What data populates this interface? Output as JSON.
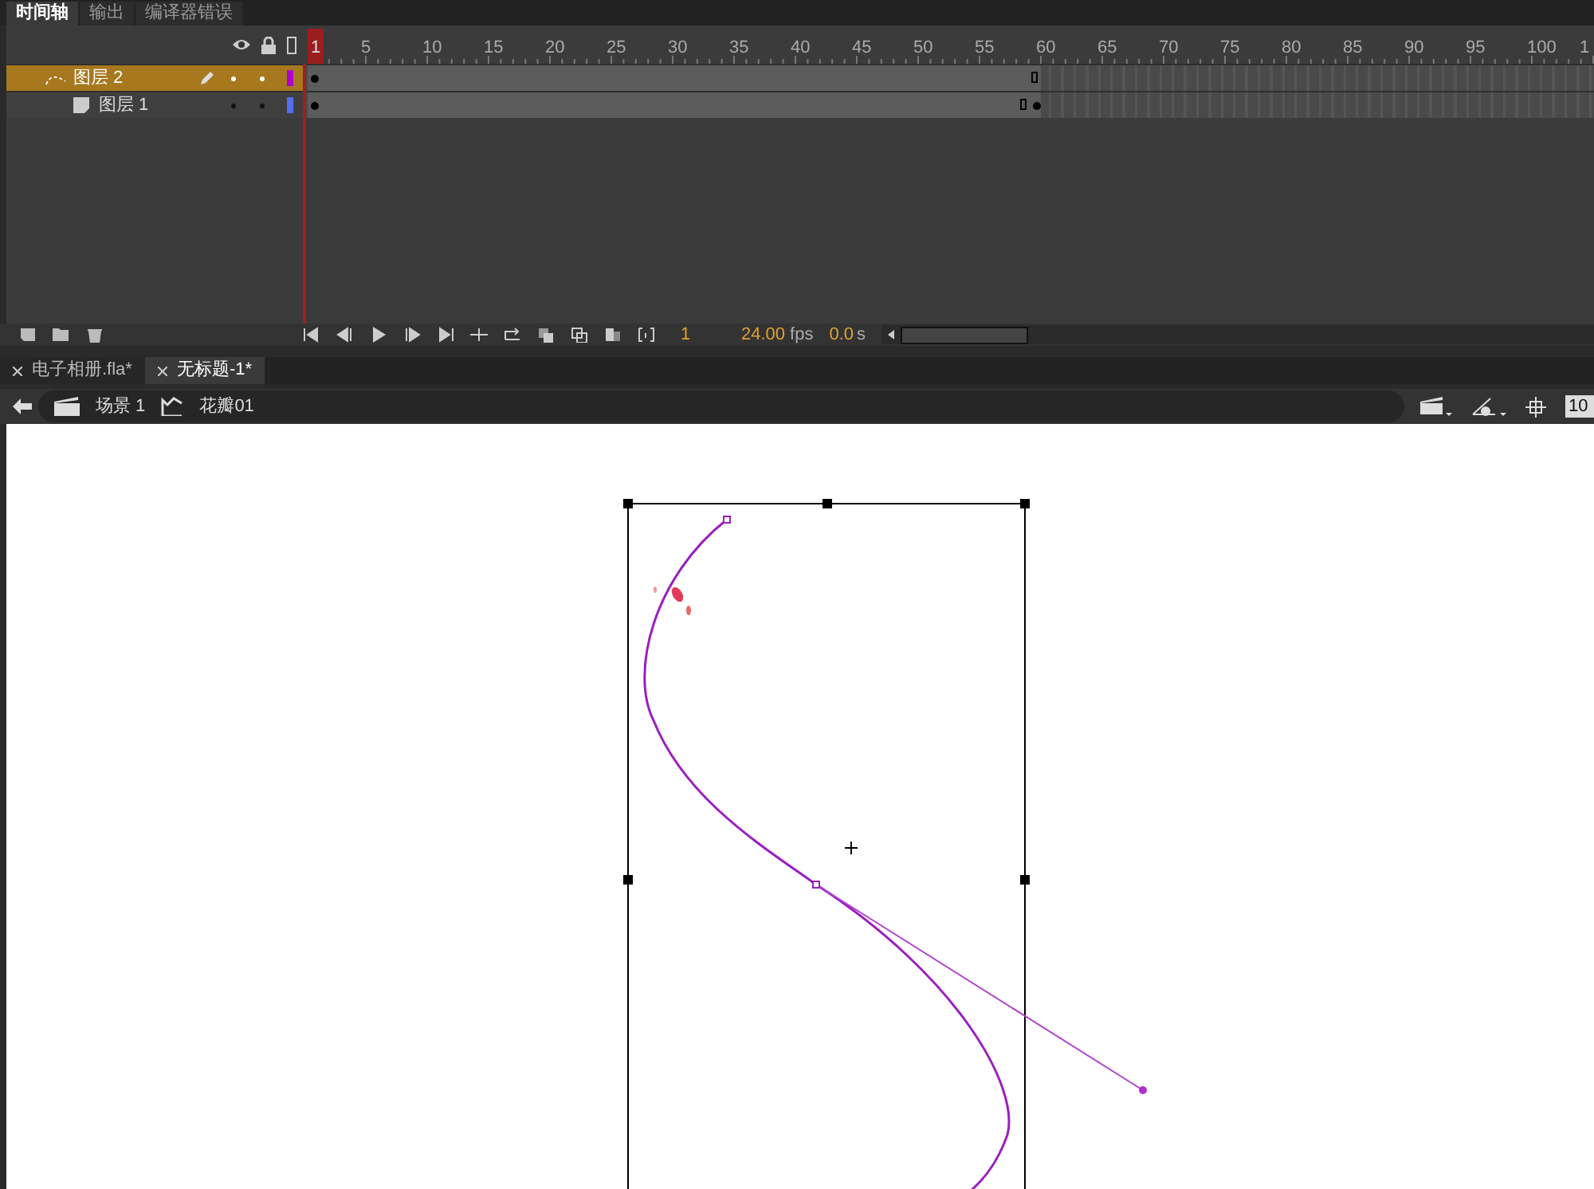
{
  "panel_tabs": [
    {
      "label": "时间轴",
      "selected": true
    },
    {
      "label": "输出",
      "selected": false
    },
    {
      "label": "编译器错误",
      "selected": false
    }
  ],
  "ruler": [
    "1",
    "5",
    "10",
    "15",
    "20",
    "25",
    "30",
    "35",
    "40",
    "45",
    "50",
    "55",
    "60",
    "65",
    "70",
    "75",
    "80",
    "85",
    "90",
    "95",
    "100",
    "1"
  ],
  "layers": [
    {
      "name": "图层 2",
      "kind": "guide",
      "selected": true,
      "color": "#b000d0"
    },
    {
      "name": "图层 1",
      "kind": "normal",
      "selected": false,
      "color": "#5070f0"
    }
  ],
  "playback": {
    "frame": "1",
    "fps": "24.00",
    "fps_unit": "fps",
    "time": "0.0",
    "time_unit": "s"
  },
  "doc_tabs": [
    {
      "label": "电子相册.fla*",
      "selected": false
    },
    {
      "label": "无标题-1*",
      "selected": true
    }
  ],
  "breadcrumbs": [
    "场景 1",
    "花瓣01"
  ],
  "zoom": "10"
}
